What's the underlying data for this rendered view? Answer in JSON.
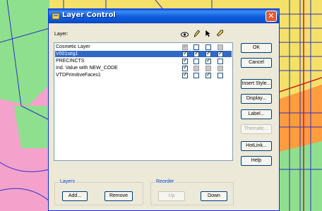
{
  "dialog": {
    "title": "Layer Control",
    "layer_header": "Layer:",
    "column_icons": [
      "eye-icon",
      "pencil-icon",
      "select-arrow-icon",
      "label-icon"
    ]
  },
  "layers": [
    {
      "name": "Cosmetic Layer",
      "selected": false,
      "checks": [
        true,
        false,
        false,
        false
      ],
      "disabled": [
        true,
        false,
        false,
        true
      ]
    },
    {
      "name": "V001seg1",
      "selected": true,
      "checks": [
        true,
        true,
        true,
        true
      ],
      "disabled": [
        false,
        false,
        false,
        false
      ]
    },
    {
      "name": "PRECINCTS",
      "selected": false,
      "checks": [
        true,
        false,
        true,
        false
      ],
      "disabled": [
        false,
        false,
        false,
        false
      ]
    },
    {
      "name": "  Ind. Value with NEW_CODE",
      "selected": false,
      "checks": [
        true,
        false,
        false,
        false
      ],
      "disabled": [
        false,
        true,
        true,
        true
      ]
    },
    {
      "name": "VTDPrimitiveFaces1",
      "selected": false,
      "checks": [
        true,
        false,
        true,
        false
      ],
      "disabled": [
        false,
        false,
        false,
        false
      ]
    }
  ],
  "buttons": {
    "ok": "OK",
    "cancel": "Cancel",
    "insert_style": "Insert Style...",
    "display": "Display...",
    "label": "Label...",
    "thematic": "Thematic...",
    "hotlink": "HotLink...",
    "help": "Help"
  },
  "layers_group": {
    "title": "Layers",
    "add": "Add...",
    "remove": "Remove"
  },
  "reorder_group": {
    "title": "Reorder",
    "up": "Up",
    "down": "Down"
  }
}
